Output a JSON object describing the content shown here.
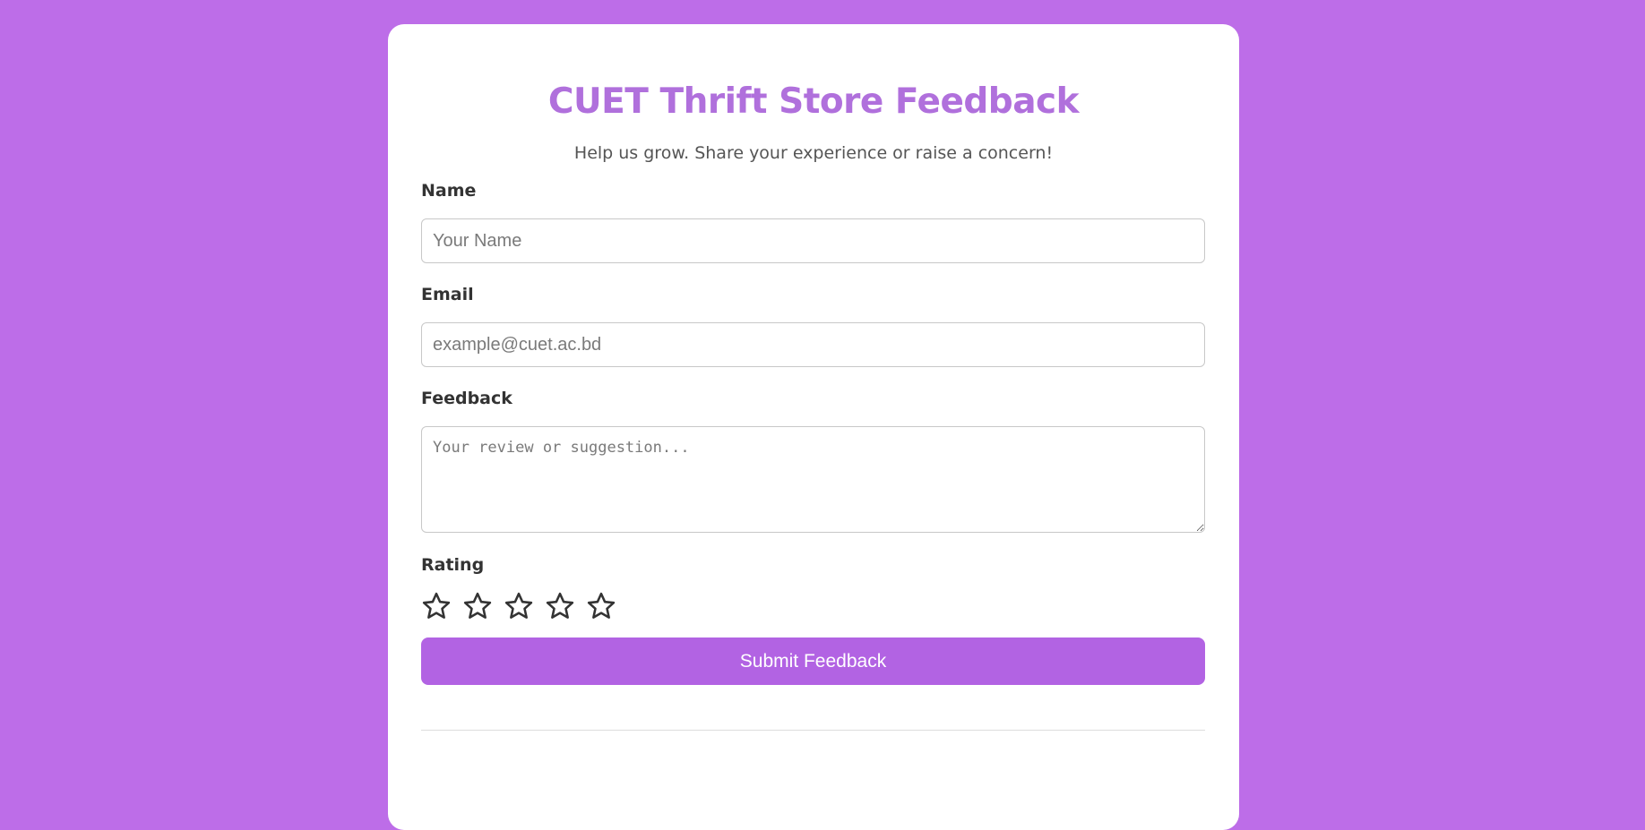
{
  "page": {
    "title": "CUET Thrift Store Feedback",
    "subtitle": "Help us grow. Share your experience or raise a concern!"
  },
  "form": {
    "name": {
      "label": "Name",
      "placeholder": "Your Name",
      "value": ""
    },
    "email": {
      "label": "Email",
      "placeholder": "example@cuet.ac.bd",
      "value": ""
    },
    "feedback": {
      "label": "Feedback",
      "placeholder": "Your review or suggestion...",
      "value": ""
    },
    "rating": {
      "label": "Rating",
      "max": 5,
      "value": 0,
      "icon": "star-outline-icon"
    },
    "submit_label": "Submit Feedback"
  },
  "colors": {
    "background": "#bd6de8",
    "accent": "#b263e3",
    "title": "#b070dc"
  }
}
